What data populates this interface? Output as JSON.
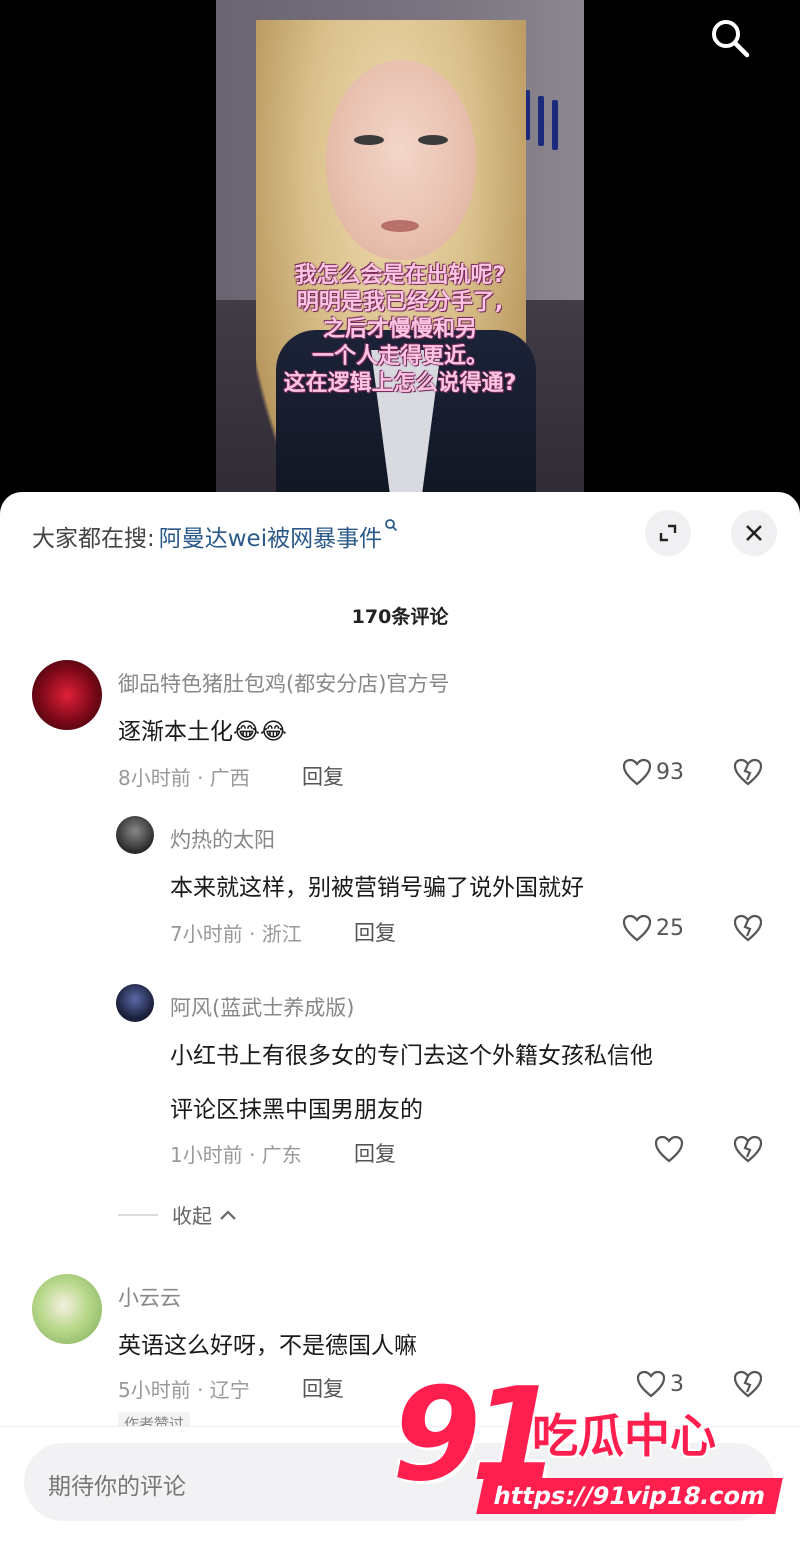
{
  "video": {
    "subtitle_lines": [
      "我怎么会是在出轨呢?",
      "明明是我已经分手了,",
      "之后才慢慢和另",
      "一个人走得更近。",
      "这在逻辑上怎么说得通?"
    ]
  },
  "hot_search": {
    "label": "大家都在搜:",
    "term": "阿曼达wei被网暴事件"
  },
  "comment_count": "170条评论",
  "comments": [
    {
      "username": "御品特色猪肚包鸡(都安分店)官方号",
      "text": "逐渐本土化😂😂",
      "meta": "8小时前 · 广西",
      "reply_label": "回复",
      "likes": "93",
      "avatar_color": "#c0102a"
    },
    {
      "username": "灼热的太阳",
      "text": "本来就这样，别被营销号骗了说外国就好",
      "meta": "7小时前 · 浙江",
      "reply_label": "回复",
      "likes": "25",
      "avatar_color": "#2a2a2a"
    },
    {
      "username": "阿风(蓝武士养成版)",
      "text_line1": "小红书上有很多女的专门去这个外籍女孩私信他",
      "text_line2": "评论区抹黑中国男朋友的",
      "meta": "1小时前 · 广东",
      "reply_label": "回复",
      "likes": "",
      "avatar_color": "#1a1f3a"
    },
    {
      "username": "小云云",
      "text": "英语这么好呀，不是德国人嘛",
      "meta": "5小时前 · 辽宁",
      "reply_label": "回复",
      "likes": "3",
      "avatar_color": "#8bbf6a"
    }
  ],
  "collapse_label": "收起",
  "author_liked_tag": "作者赞过",
  "input_placeholder": "期待你的评论",
  "watermark": {
    "number": "91",
    "brand": "吃瓜中心",
    "url": "https://91vip18.com"
  },
  "colors": {
    "hot_term": "#2b5a8a",
    "watermark": "#ff1f4f",
    "subtitle": "#ffc6e4"
  }
}
